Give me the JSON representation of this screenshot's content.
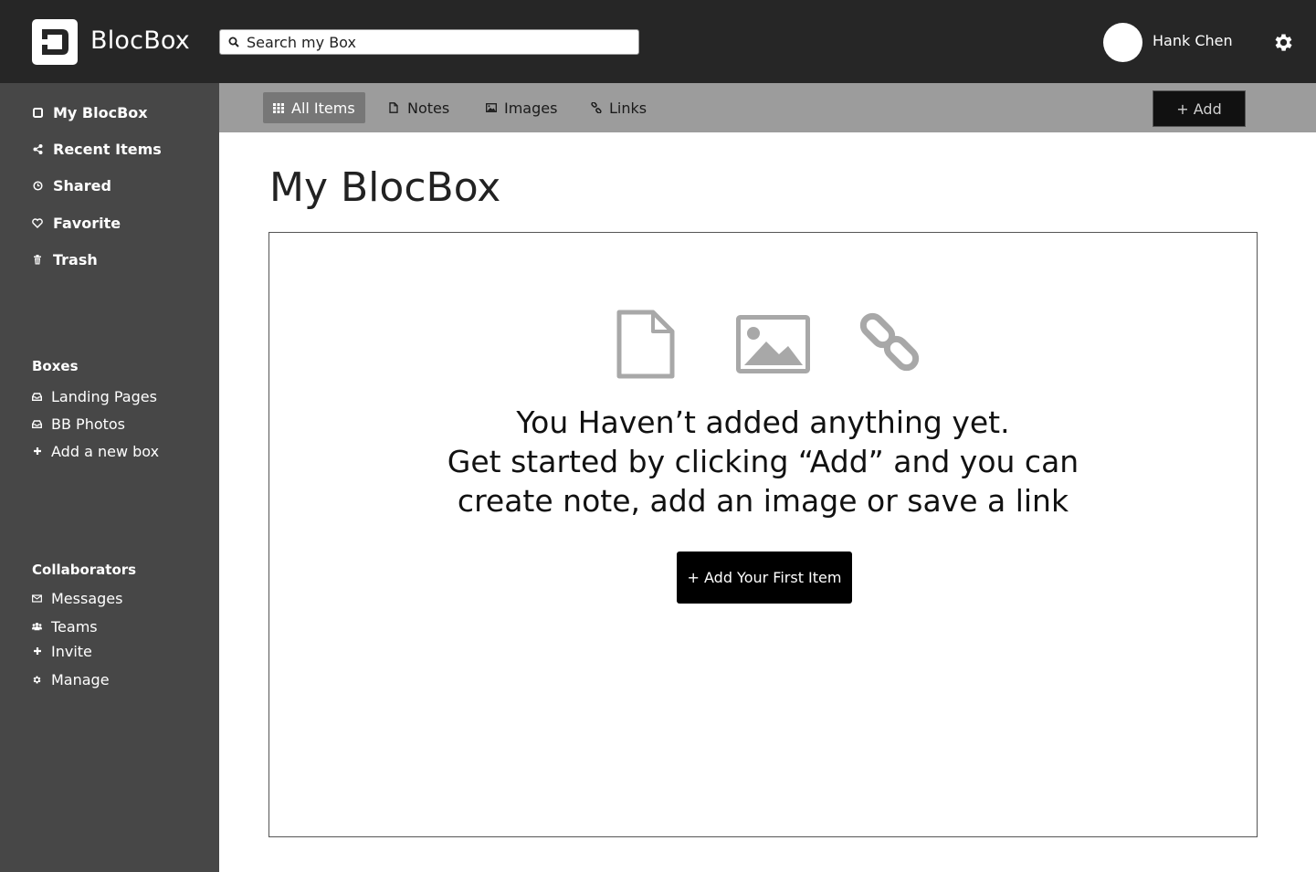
{
  "header": {
    "brand": "BlocBox",
    "logo_icon": "blocbox-logo-icon",
    "search": {
      "placeholder": "Search my Box",
      "value": "",
      "icon": "search-icon"
    },
    "user": {
      "name": "Hank Chen"
    },
    "settings_icon": "gear-icon"
  },
  "sidebar": {
    "nav": [
      {
        "label": "My BlocBox",
        "icon": "box-icon"
      },
      {
        "label": "Recent Items",
        "icon": "share-icon"
      },
      {
        "label": "Shared",
        "icon": "clock-icon"
      },
      {
        "label": "Favorite",
        "icon": "heart-icon"
      },
      {
        "label": "Trash",
        "icon": "trash-icon"
      }
    ],
    "boxes": {
      "title": "Boxes",
      "items": [
        {
          "label": "Landing Pages",
          "icon": "inbox-icon"
        },
        {
          "label": "BB Photos",
          "icon": "inbox-icon"
        },
        {
          "label": "Add a new box",
          "icon": "plus-icon"
        }
      ]
    },
    "collaborators": {
      "title": "Collaborators",
      "items": [
        {
          "label": "Messages",
          "icon": "envelope-icon"
        },
        {
          "label": "Teams",
          "icon": "users-icon"
        },
        {
          "label": "Invite",
          "icon": "plus-icon"
        },
        {
          "label": "Manage",
          "icon": "cog-icon"
        }
      ]
    }
  },
  "tabs": [
    {
      "label": "All Items",
      "icon": "grid-icon",
      "active": true
    },
    {
      "label": "Notes",
      "icon": "file-icon",
      "active": false
    },
    {
      "label": "Images",
      "icon": "image-icon",
      "active": false
    },
    {
      "label": "Links",
      "icon": "link-icon",
      "active": false
    }
  ],
  "toolbar": {
    "add_label": "+ Add"
  },
  "main": {
    "title": "My BlocBox",
    "empty_state": {
      "lines": [
        "You Haven’t added anything yet.",
        "Get started by clicking “Add” and you can",
        "create note, add an image or save a link"
      ],
      "icons": [
        "file-icon",
        "image-icon",
        "link-icon"
      ],
      "button_label": "+ Add Your First Item"
    }
  },
  "colors": {
    "header_bg": "#262626",
    "sidebar_bg": "#474747",
    "tabbar_bg": "#9c9c9c",
    "active_tab_bg": "#777777",
    "icon_gray": "#a8a8a8",
    "button_bg": "#000000"
  }
}
